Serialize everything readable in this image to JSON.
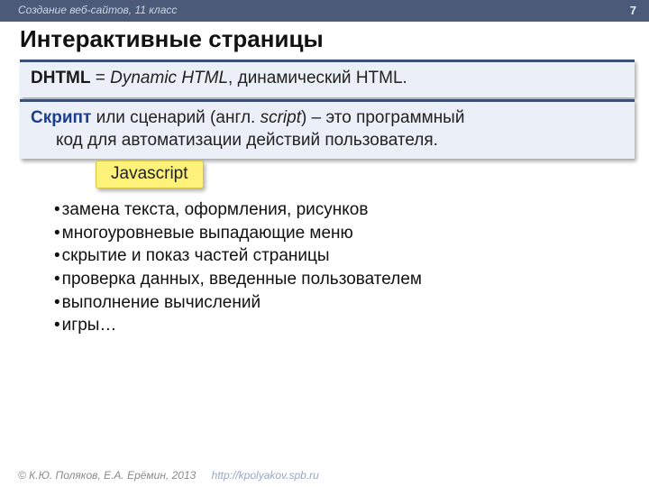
{
  "topbar": {
    "course": "Создание веб-сайтов, 11 класс",
    "page": "7"
  },
  "title": "Интерактивные страницы",
  "card1": {
    "term": "DHTML",
    "eq": " = ",
    "expansion": "Dynamic HTML",
    "rest": ", динамический HTML."
  },
  "card2": {
    "term": "Скрипт",
    "mid1": " или сценарий (англ. ",
    "eng": "script",
    "mid2": ") – это программный",
    "line2": "код для автоматизации действий пользователя."
  },
  "tag": "Javascript",
  "bullets": [
    "замена текста, оформления, рисунков",
    "многоуровневые выпадающие меню",
    "скрытие и показ частей страницы",
    "проверка данных, введенные пользователем",
    "выполнение вычислений",
    "игры…"
  ],
  "footer": {
    "credit": "© К.Ю. Поляков, Е.А. Ерёмин, 2013",
    "url": "http://kpolyakov.spb.ru"
  }
}
